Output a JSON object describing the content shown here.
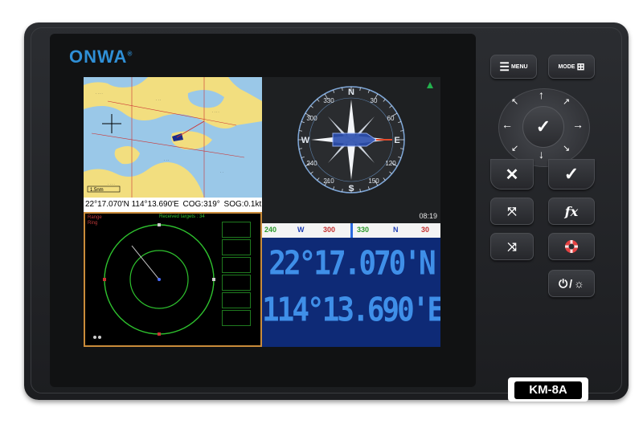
{
  "device": {
    "brand": "ONWA",
    "brand_mark": "®",
    "model": "KM-8A"
  },
  "chart_panel": {
    "status": {
      "position": "22°17.070'N 114°13.690'E",
      "cog_label": "COG:",
      "cog_value": "319°",
      "sog_label": "SOG:",
      "sog_value": "0.1kt"
    },
    "scale_label": "1.5nm"
  },
  "compass_panel": {
    "cardinals": {
      "n": "N",
      "e": "E",
      "s": "S",
      "w": "W"
    },
    "degrees": [
      "30",
      "60",
      "120",
      "150",
      "210",
      "240",
      "300",
      "330"
    ],
    "time": "08:19"
  },
  "radar_panel": {
    "range_label": "Range",
    "ring_label": "Ring",
    "targets_label": "Received targets : 34"
  },
  "nav_panel": {
    "heading_tape": [
      "240",
      "W",
      "300",
      "330",
      "N",
      "30"
    ],
    "latitude": "22°17.070'N",
    "longitude": "114°13.690'E"
  },
  "keys": {
    "menu": "MENU",
    "mode": "MODE",
    "function": "fx"
  },
  "colors": {
    "brand": "#2f8fd6",
    "nav_digits": "#3f8fe8",
    "nav_background": "#0e2a76",
    "chart_land": "#f2de7f",
    "chart_water": "#9ac8e8",
    "radar_ring": "#2ec22e",
    "radar_border": "#c98b3a"
  }
}
